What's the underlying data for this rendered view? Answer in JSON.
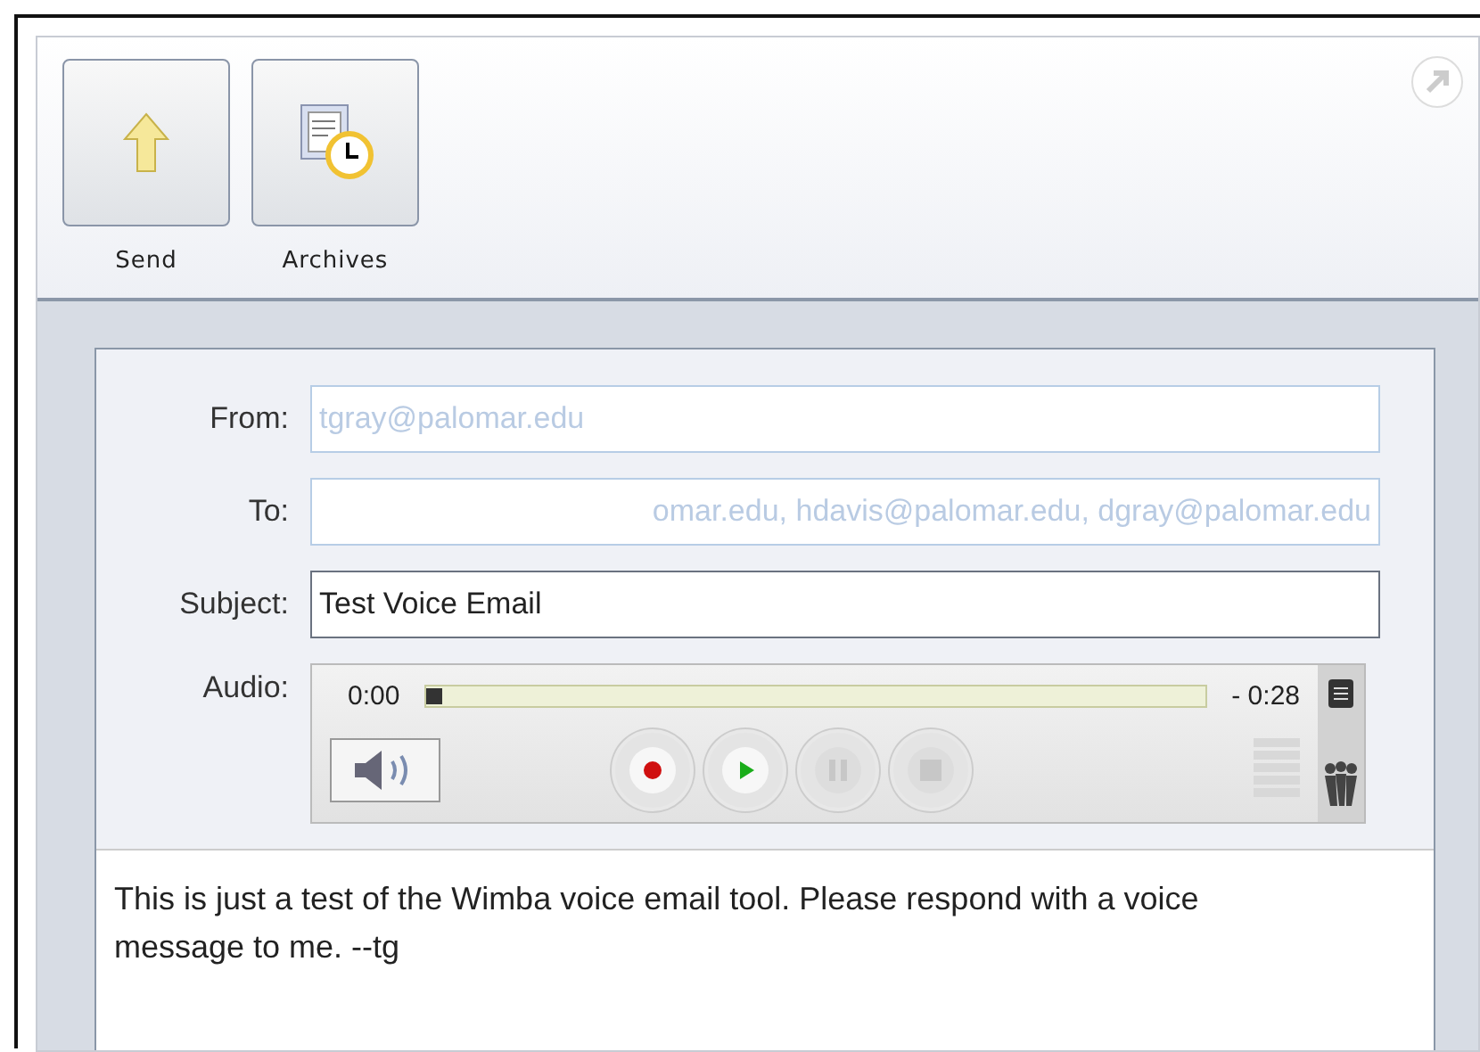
{
  "toolbar": {
    "buttons": [
      {
        "kind": "send",
        "label": "Send"
      },
      {
        "kind": "archives",
        "label": "Archives"
      }
    ]
  },
  "form": {
    "fields": [
      {
        "label": "From:",
        "value": "tgray@palomar.edu",
        "disabled": true
      },
      {
        "label": "To:",
        "value": "omar.edu, hdavis@palomar.edu, dgray@palomar.edu",
        "disabled": true
      },
      {
        "label": "Subject:",
        "value": "Test Voice Email",
        "disabled": false
      }
    ],
    "audio": {
      "label": "Audio:",
      "elapsed": "0:00",
      "remaining": "- 0:28",
      "level": 0.0,
      "controls": [
        {
          "kind": "record",
          "disabled": false
        },
        {
          "kind": "play",
          "disabled": false
        },
        {
          "kind": "pause",
          "disabled": true
        },
        {
          "kind": "stop",
          "disabled": true
        }
      ]
    }
  },
  "message": "This is just a test of the Wimba voice email tool.  Please respond with a voice message to me. --tg"
}
